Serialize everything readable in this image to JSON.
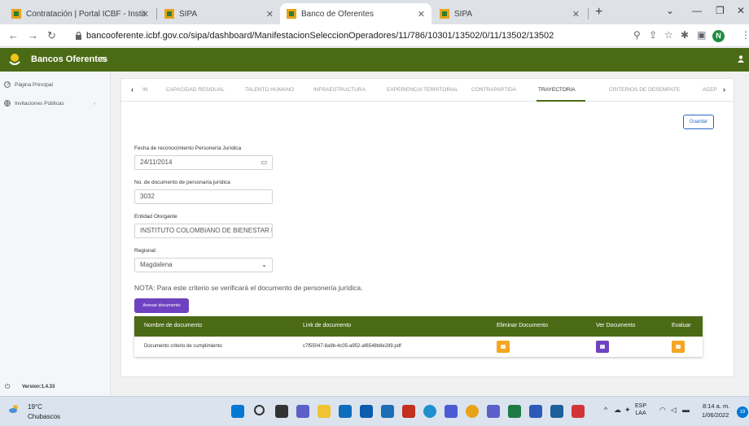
{
  "browser": {
    "tabs": [
      {
        "title": "Contratación | Portal ICBF - Instit",
        "active": false
      },
      {
        "title": "SIPA",
        "active": false
      },
      {
        "title": "Banco de Oferentes",
        "active": true
      },
      {
        "title": "SIPA",
        "active": false
      }
    ],
    "url": "bancooferente.icbf.gov.co/sipa/dashboard/ManifestacionSeleccionOperadores/11/786/10301/13502/0/11/13502/13502",
    "profile_initial": "N"
  },
  "app": {
    "brand": "Bancos Oferentes",
    "header_color": "#4b6a16"
  },
  "sidebar": {
    "items": [
      {
        "label": "Página Principal"
      },
      {
        "label": "Invitaciones Públicas"
      }
    ],
    "version": "Version:1.4.33"
  },
  "form_tabs": {
    "prev": "‹",
    "next": "›",
    "items": [
      "IN",
      "CAPACIDAD RESIDUAL",
      "TALENTO HUMANO",
      "INFRAESTRUCTURA",
      "EXPERIENCIA TERRITORIAL",
      "CONTRAPARTIDA",
      "TRAYECTORIA",
      "CRITERIOS DE DESEMPATE",
      "ACEP"
    ],
    "active": "TRAYECTORIA"
  },
  "form": {
    "save_label": "Guardar",
    "fecha": {
      "label": "Fecha de reconocimiento Personería Jurídica",
      "value": "24/11/2014"
    },
    "documento": {
      "label": "No. de documento de personaría jurídica",
      "value": "3032"
    },
    "entidad": {
      "label": "Entidad Otorgante",
      "value": "INSTITUTO COLOMBIANO DE BIENESTAR F"
    },
    "regional": {
      "label": "Regional:",
      "value": "Magdalena"
    },
    "nota": "NOTA: Para este criterio se verificará el documento de personería jurídica.",
    "anexar_label": "Anexar documento"
  },
  "docs_table": {
    "headers": [
      "Nombre de documento",
      "Link de documento",
      "Eliminar Documento",
      "Ver Documento",
      "Evaluar"
    ],
    "rows": [
      {
        "nombre": "Documento criterio de cumplimiento",
        "link": "c7f55047-8a9b-4c05-a952-af6548b8e289.pdf"
      }
    ],
    "action_colors": {
      "eliminar": "#f5a623",
      "ver": "#6f42c1",
      "evaluar": "#f5a623"
    }
  },
  "taskbar": {
    "temp": "19°C",
    "weather": "Chubascos",
    "lang_top": "ESP",
    "lang_bottom": "LAA",
    "time": "8:14 a. m.",
    "date": "1/06/2022",
    "notifications": "19"
  }
}
